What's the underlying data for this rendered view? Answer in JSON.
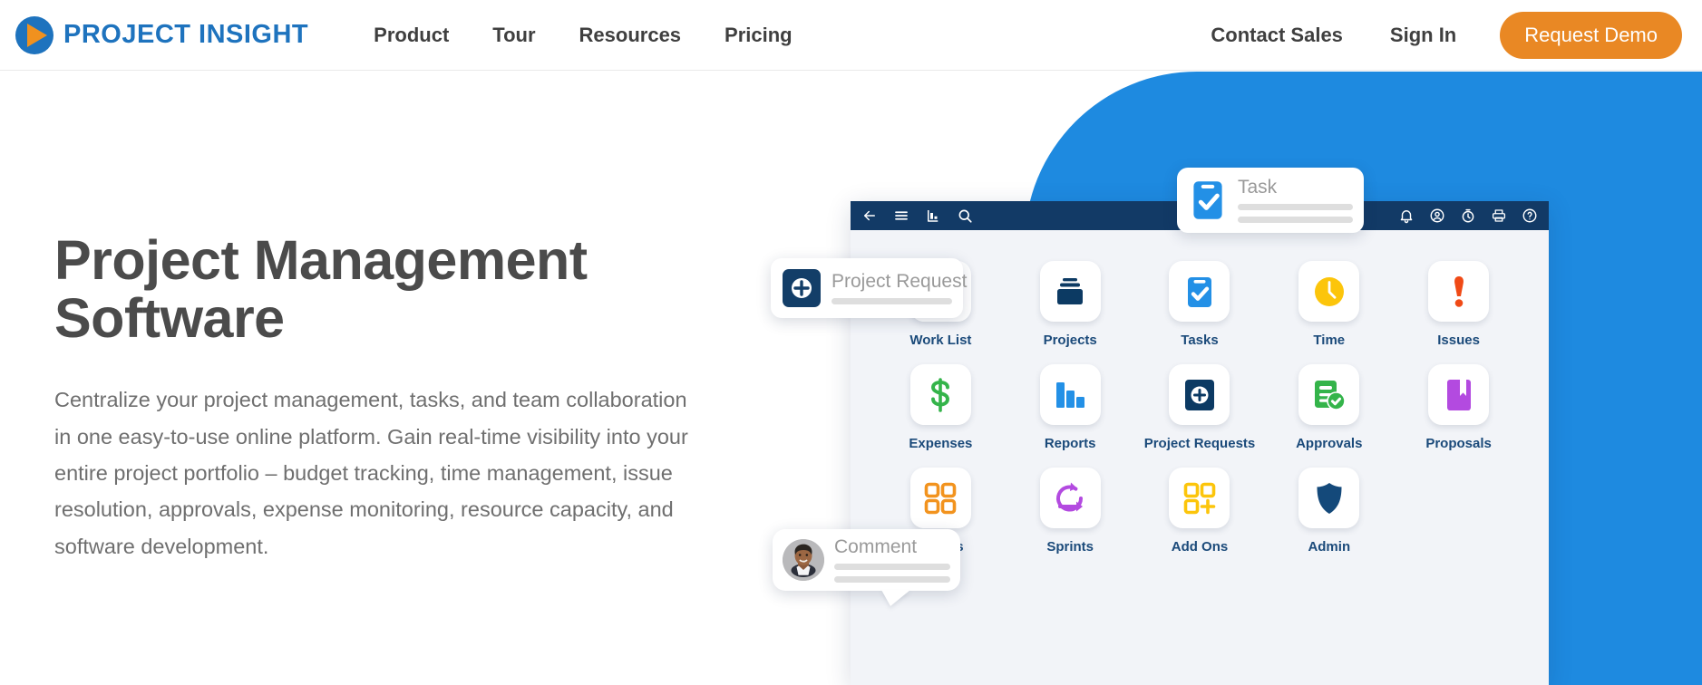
{
  "header": {
    "logo": {
      "icon": "play-circle-logo-icon",
      "text": "PROJECT INSIGHT",
      "color": "#1e73be",
      "accent": "#f0911f"
    },
    "nav_main": [
      {
        "label": "Product",
        "name": "nav-item-product"
      },
      {
        "label": "Tour",
        "name": "nav-item-tour"
      },
      {
        "label": "Resources",
        "name": "nav-item-resources"
      },
      {
        "label": "Pricing",
        "name": "nav-item-pricing"
      }
    ],
    "nav_right": [
      {
        "label": "Contact Sales",
        "name": "nav-item-contact-sales"
      },
      {
        "label": "Sign In",
        "name": "nav-item-sign-in"
      }
    ],
    "cta_label": "Request Demo",
    "cta_color": "#e98824"
  },
  "hero": {
    "title": "Project Management Software",
    "body": "Centralize your project management, tasks, and team collaboration in one easy-to-use online platform. Gain real-time visibility into your entire project portfolio – budget tracking, time management, issue resolution, approvals, expense monitoring, resource capacity, and software development.",
    "background_color": "#1e8ae0"
  },
  "app_mockup": {
    "toolbar": {
      "background": "#123a66",
      "left_icons": [
        "back-arrow-icon",
        "hamburger-menu-icon",
        "chart-icon",
        "search-icon"
      ],
      "right_icons": [
        "bell-icon",
        "account-icon",
        "timer-icon",
        "printer-icon",
        "help-icon"
      ]
    },
    "tiles": [
      {
        "label": "Work List",
        "icon": "bullet-list-icon",
        "color": "#f2931e"
      },
      {
        "label": "Projects",
        "icon": "archive-box-icon",
        "color": "#0c3a63"
      },
      {
        "label": "Tasks",
        "icon": "clipboard-check-icon",
        "color": "#2390e6"
      },
      {
        "label": "Time",
        "icon": "clock-icon",
        "color": "#fcc50b"
      },
      {
        "label": "Issues",
        "icon": "exclamation-icon",
        "color": "#f04a16"
      },
      {
        "label": "Expenses",
        "icon": "dollar-sign-icon",
        "color": "#34b44a"
      },
      {
        "label": "Reports",
        "icon": "bar-chart-icon",
        "color": "#2390e6"
      },
      {
        "label": "Project Requests",
        "icon": "plus-square-icon",
        "color": "#0c3a63"
      },
      {
        "label": "Approvals",
        "icon": "approval-check-icon",
        "color": "#34b44a"
      },
      {
        "label": "Proposals",
        "icon": "bookmark-book-icon",
        "color": "#b34ae0"
      },
      {
        "label": "To-Dos",
        "icon": "grid-squares-icon",
        "color": "#f2931e"
      },
      {
        "label": "Sprints",
        "icon": "refresh-loop-icon",
        "color": "#b34ae0"
      },
      {
        "label": "Add Ons",
        "icon": "grid-plus-icon",
        "color": "#fcc50b"
      },
      {
        "label": "Admin",
        "icon": "shield-icon",
        "color": "#14497a"
      }
    ]
  },
  "floating_cards": {
    "task": {
      "title": "Task",
      "icon": "clipboard-check-icon",
      "icon_color": "#2390e6"
    },
    "project_request": {
      "title": "Project Request",
      "icon": "plus-circle-icon",
      "icon_color": "#0c3a63"
    },
    "comment": {
      "title": "Comment",
      "icon": "user-avatar-photo"
    }
  }
}
